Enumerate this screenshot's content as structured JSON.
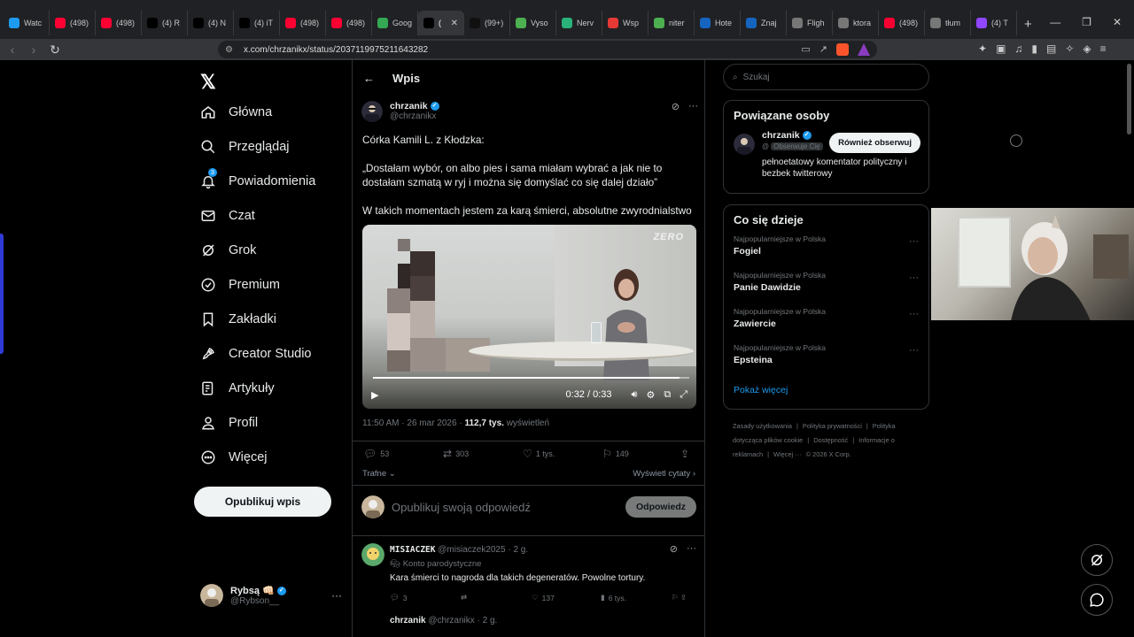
{
  "browser": {
    "tabs": [
      {
        "label": "Watc",
        "color": "#1d9bf0"
      },
      {
        "label": "(498)",
        "color": "#ff0033"
      },
      {
        "label": "(498)",
        "color": "#ff0033"
      },
      {
        "label": "(4) R",
        "color": "#000000"
      },
      {
        "label": "(4) N",
        "color": "#000000"
      },
      {
        "label": "(4) iT",
        "color": "#000000"
      },
      {
        "label": "(498)",
        "color": "#ff0033"
      },
      {
        "label": "(498)",
        "color": "#ff0033"
      },
      {
        "label": "Goog",
        "color": "#34a853"
      },
      {
        "label": "(",
        "color": "#000000",
        "active": true
      },
      {
        "label": "(99+)",
        "color": "#111111"
      },
      {
        "label": "Vyso",
        "color": "#4caf50"
      },
      {
        "label": "Nerv",
        "color": "#2ab27b"
      },
      {
        "label": "Wsp",
        "color": "#e53935"
      },
      {
        "label": "niter",
        "color": "#4caf50"
      },
      {
        "label": "Hote",
        "color": "#1565c0"
      },
      {
        "label": "Znaj",
        "color": "#1565c0"
      },
      {
        "label": "Fligh",
        "color": "#777777"
      },
      {
        "label": "ktora",
        "color": "#777777"
      },
      {
        "label": "(498)",
        "color": "#ff0033"
      },
      {
        "label": "tłum",
        "color": "#777777"
      },
      {
        "label": "(4) T",
        "color": "#9146ff"
      }
    ],
    "url": "x.com/chrzanikx/status/2037119975211643282"
  },
  "nav": {
    "home": "Główna",
    "explore": "Przeglądaj",
    "notifications": "Powiadomienia",
    "notifications_badge": "3",
    "chat": "Czat",
    "grok": "Grok",
    "premium": "Premium",
    "bookmarks": "Zakładki",
    "creator_studio": "Creator Studio",
    "articles": "Artykuły",
    "profile": "Profil",
    "more": "Więcej",
    "post_button": "Opublikuj wpis"
  },
  "current_user": {
    "name": "Rybsą 👊🏻",
    "handle": "@Rybson__"
  },
  "post": {
    "header": "Wpis",
    "author_name": "chrzanik",
    "author_handle": "@chrzanikx",
    "line1": "Córka Kamili L. z Kłodzka:",
    "line2": "„Dostałam wybór, on albo pies i sama miałam wybrać a jak nie to dostałam szmatą w ryj i można się domyślać co się dalej działo”",
    "line3": "W takich momentach jestem za karą śmierci, absolutne zwyrodnialstwo",
    "video": {
      "watermark": "ZERO",
      "time": "0:32 / 0:33",
      "progress": 0.97
    },
    "timestamp": "11:50 AM · 26 mar 2026 · ",
    "views": "112,7 tys.",
    "views_label": " wyświetleń",
    "replies": "53",
    "reposts": "303",
    "likes": "1 tys.",
    "bookmarks": "149",
    "sort": "Trafne",
    "quotes": "Wyświetl cytaty"
  },
  "reply_box": {
    "placeholder": "Opublikuj swoją odpowiedź",
    "button": "Odpowiedz"
  },
  "comment": {
    "name": "MISIACZEK",
    "handle": "@misiaczek2025 · 2 g.",
    "parody": "Konto parodystyczne",
    "text": "Kara śmierci to nagroda dla takich degeneratów. Powolne tortury.",
    "replies": "3",
    "likes": "137",
    "views": "6 tys."
  },
  "next_comment": {
    "name": "chrzanik",
    "handle": "@chrzanikx · 2 g."
  },
  "sidebar": {
    "search_placeholder": "Szukaj",
    "related_title": "Powiązane osoby",
    "related": {
      "name": "chrzanik",
      "handle": "@",
      "follows_you": "Obserwuje Cię",
      "follow_back": "Również obserwuj",
      "bio": "pełnoetatowy komentator polityczny i bezbek twitterowy"
    },
    "happening_title": "Co się dzieje",
    "trends": [
      {
        "category": "Najpopularniejsze w Polska",
        "name": "Fogiel"
      },
      {
        "category": "Najpopularniejsze w Polska",
        "name": "Panie Dawidzie"
      },
      {
        "category": "Najpopularniejsze w Polska",
        "name": "Zawiercie"
      },
      {
        "category": "Najpopularniejsze w Polska",
        "name": "Epsteina"
      }
    ],
    "show_more": "Pokaż więcej",
    "footer": [
      "Zasady użytkowania",
      "|",
      "Polityka prywatności",
      "|",
      "Polityka dotycząca plików cookie",
      "|",
      "Dostępność",
      "|",
      "Informacje o reklamach",
      "|",
      "Więcej ···",
      "© 2026 X Corp."
    ]
  }
}
